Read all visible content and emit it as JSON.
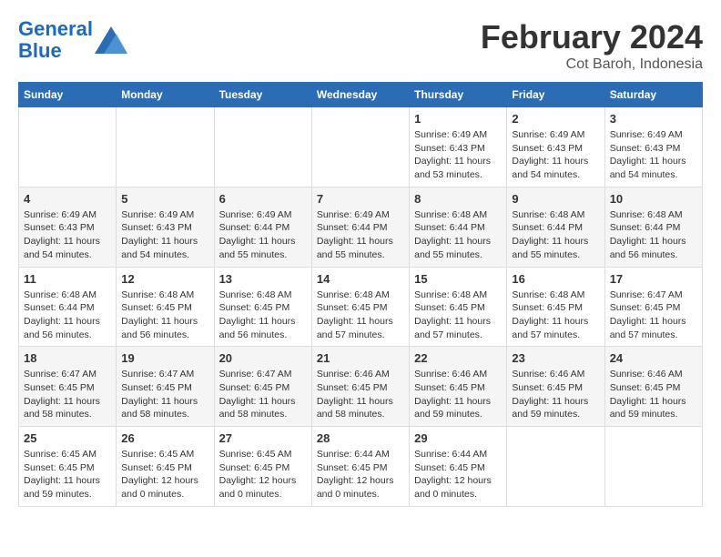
{
  "header": {
    "logo_line1": "General",
    "logo_line2": "Blue",
    "title": "February 2024",
    "subtitle": "Cot Baroh, Indonesia"
  },
  "weekdays": [
    "Sunday",
    "Monday",
    "Tuesday",
    "Wednesday",
    "Thursday",
    "Friday",
    "Saturday"
  ],
  "weeks": [
    [
      {
        "day": "",
        "info": ""
      },
      {
        "day": "",
        "info": ""
      },
      {
        "day": "",
        "info": ""
      },
      {
        "day": "",
        "info": ""
      },
      {
        "day": "1",
        "info": "Sunrise: 6:49 AM\nSunset: 6:43 PM\nDaylight: 11 hours\nand 53 minutes."
      },
      {
        "day": "2",
        "info": "Sunrise: 6:49 AM\nSunset: 6:43 PM\nDaylight: 11 hours\nand 54 minutes."
      },
      {
        "day": "3",
        "info": "Sunrise: 6:49 AM\nSunset: 6:43 PM\nDaylight: 11 hours\nand 54 minutes."
      }
    ],
    [
      {
        "day": "4",
        "info": "Sunrise: 6:49 AM\nSunset: 6:43 PM\nDaylight: 11 hours\nand 54 minutes."
      },
      {
        "day": "5",
        "info": "Sunrise: 6:49 AM\nSunset: 6:43 PM\nDaylight: 11 hours\nand 54 minutes."
      },
      {
        "day": "6",
        "info": "Sunrise: 6:49 AM\nSunset: 6:44 PM\nDaylight: 11 hours\nand 55 minutes."
      },
      {
        "day": "7",
        "info": "Sunrise: 6:49 AM\nSunset: 6:44 PM\nDaylight: 11 hours\nand 55 minutes."
      },
      {
        "day": "8",
        "info": "Sunrise: 6:48 AM\nSunset: 6:44 PM\nDaylight: 11 hours\nand 55 minutes."
      },
      {
        "day": "9",
        "info": "Sunrise: 6:48 AM\nSunset: 6:44 PM\nDaylight: 11 hours\nand 55 minutes."
      },
      {
        "day": "10",
        "info": "Sunrise: 6:48 AM\nSunset: 6:44 PM\nDaylight: 11 hours\nand 56 minutes."
      }
    ],
    [
      {
        "day": "11",
        "info": "Sunrise: 6:48 AM\nSunset: 6:44 PM\nDaylight: 11 hours\nand 56 minutes."
      },
      {
        "day": "12",
        "info": "Sunrise: 6:48 AM\nSunset: 6:45 PM\nDaylight: 11 hours\nand 56 minutes."
      },
      {
        "day": "13",
        "info": "Sunrise: 6:48 AM\nSunset: 6:45 PM\nDaylight: 11 hours\nand 56 minutes."
      },
      {
        "day": "14",
        "info": "Sunrise: 6:48 AM\nSunset: 6:45 PM\nDaylight: 11 hours\nand 57 minutes."
      },
      {
        "day": "15",
        "info": "Sunrise: 6:48 AM\nSunset: 6:45 PM\nDaylight: 11 hours\nand 57 minutes."
      },
      {
        "day": "16",
        "info": "Sunrise: 6:48 AM\nSunset: 6:45 PM\nDaylight: 11 hours\nand 57 minutes."
      },
      {
        "day": "17",
        "info": "Sunrise: 6:47 AM\nSunset: 6:45 PM\nDaylight: 11 hours\nand 57 minutes."
      }
    ],
    [
      {
        "day": "18",
        "info": "Sunrise: 6:47 AM\nSunset: 6:45 PM\nDaylight: 11 hours\nand 58 minutes."
      },
      {
        "day": "19",
        "info": "Sunrise: 6:47 AM\nSunset: 6:45 PM\nDaylight: 11 hours\nand 58 minutes."
      },
      {
        "day": "20",
        "info": "Sunrise: 6:47 AM\nSunset: 6:45 PM\nDaylight: 11 hours\nand 58 minutes."
      },
      {
        "day": "21",
        "info": "Sunrise: 6:46 AM\nSunset: 6:45 PM\nDaylight: 11 hours\nand 58 minutes."
      },
      {
        "day": "22",
        "info": "Sunrise: 6:46 AM\nSunset: 6:45 PM\nDaylight: 11 hours\nand 59 minutes."
      },
      {
        "day": "23",
        "info": "Sunrise: 6:46 AM\nSunset: 6:45 PM\nDaylight: 11 hours\nand 59 minutes."
      },
      {
        "day": "24",
        "info": "Sunrise: 6:46 AM\nSunset: 6:45 PM\nDaylight: 11 hours\nand 59 minutes."
      }
    ],
    [
      {
        "day": "25",
        "info": "Sunrise: 6:45 AM\nSunset: 6:45 PM\nDaylight: 11 hours\nand 59 minutes."
      },
      {
        "day": "26",
        "info": "Sunrise: 6:45 AM\nSunset: 6:45 PM\nDaylight: 12 hours\nand 0 minutes."
      },
      {
        "day": "27",
        "info": "Sunrise: 6:45 AM\nSunset: 6:45 PM\nDaylight: 12 hours\nand 0 minutes."
      },
      {
        "day": "28",
        "info": "Sunrise: 6:44 AM\nSunset: 6:45 PM\nDaylight: 12 hours\nand 0 minutes."
      },
      {
        "day": "29",
        "info": "Sunrise: 6:44 AM\nSunset: 6:45 PM\nDaylight: 12 hours\nand 0 minutes."
      },
      {
        "day": "",
        "info": ""
      },
      {
        "day": "",
        "info": ""
      }
    ]
  ]
}
